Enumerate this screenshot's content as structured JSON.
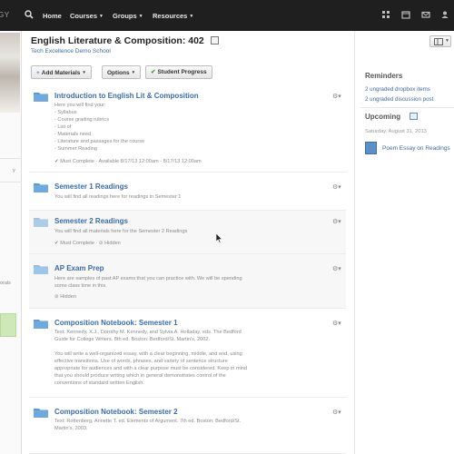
{
  "nav": {
    "logo_text": "GY",
    "items": [
      {
        "label": "Home",
        "has_caret": false
      },
      {
        "label": "Courses",
        "has_caret": true
      },
      {
        "label": "Groups",
        "has_caret": true
      },
      {
        "label": "Resources",
        "has_caret": true
      }
    ]
  },
  "course": {
    "title": "English Literature & Composition: 402",
    "school": "Tech Excellence Demo School"
  },
  "toolbar": {
    "add_materials": "Add Materials",
    "options": "Options",
    "student_progress": "Student Progress"
  },
  "materials": [
    {
      "title": "Introduction to English Lit & Composition",
      "desc": [
        "Here you will find your:",
        "- Syllabus",
        "- Course grading rubrics",
        "- List of",
        "- Materials need",
        "- Literature and passages for the course",
        "- Summer Reading"
      ],
      "meta": "✔ Must Complete · Available 8/17/13 12:00am - 8/17/13 12:00am"
    },
    {
      "title": "Semester 1 Readings",
      "desc": [
        "You will find all readings here for readings in Semester 1"
      ],
      "meta": ""
    },
    {
      "title": "Semester 2 Readings",
      "desc": [
        "You will find all materials here for the Semester 2 Readings"
      ],
      "meta": "✔ Must Complete · ⊘ Hidden"
    },
    {
      "title": "AP Exam Prep",
      "desc": [
        "Here are samples of past AP exams that you can practice with. We will be spending",
        "some class time in this."
      ],
      "meta": "⊘ Hidden"
    },
    {
      "title": "Composition Notebook: Semester 1",
      "desc": [
        "Text: Kennedy, X.J., Dorothy M. Kennedy, and Sylvia A. Holladay, eds. The Bedford",
        "Guide for College Writers. 8th ed. Boston: Bedford/St. Martin's, 2002.",
        "",
        "You will write a well-organized essay, with a clear beginning, middle, and end, using",
        "effective transitions. Use of words, phrases, and variety of sentence structure",
        "appropriate for audiences and with a clear purpose must be considered. Keep in mind",
        "that you should produce writing which in general demonstrates control of the",
        "conventions of standard written English."
      ],
      "meta": ""
    },
    {
      "title": "Composition Notebook: Semester 2",
      "desc": [
        "Text: Rottenberg, Annette T. ed. Elements of Argument. 7th ed. Boston: Bedford/St.",
        "Martin's, 2003."
      ],
      "meta": ""
    }
  ],
  "sidebar": {
    "reminders_title": "Reminders",
    "reminders": [
      "2 ungraded dropbox items",
      "2 ungraded discussion post"
    ],
    "upcoming_title": "Upcoming",
    "upcoming_date": "Saturday, August 31, 2013",
    "upcoming_event": "Poem Essay on Readings"
  },
  "left_hints": {
    "a": "y",
    "b": "orals"
  },
  "colors": {
    "nav_bg": "#1f1f1f",
    "link": "#3b6ca8",
    "folder": "#5a9bd5"
  }
}
